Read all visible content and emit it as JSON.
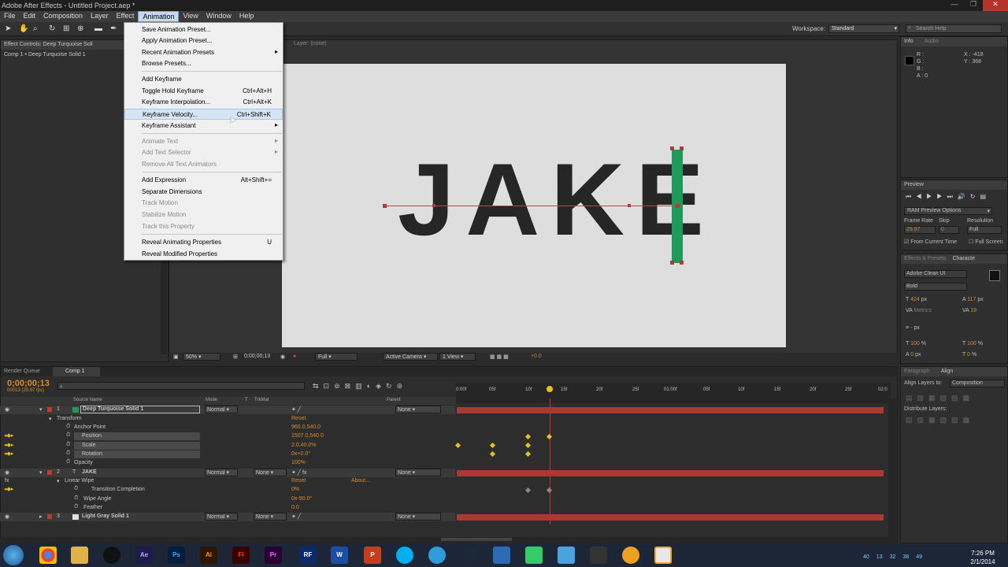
{
  "window": {
    "title": "Adobe After Effects - Untitled Project.aep *"
  },
  "menubar": {
    "items": [
      "File",
      "Edit",
      "Composition",
      "Layer",
      "Effect",
      "Animation",
      "View",
      "Window",
      "Help"
    ]
  },
  "animation_menu": {
    "save_preset": "Save Animation Preset...",
    "apply_preset": "Apply Animation Preset...",
    "recent_presets": "Recent Animation Presets",
    "browse_presets": "Browse Presets...",
    "add_keyframe": "Add Keyframe",
    "toggle_hold": "Toggle Hold Keyframe",
    "toggle_hold_sc": "Ctrl+Alt+H",
    "kf_interp": "Keyframe Interpolation...",
    "kf_interp_sc": "Ctrl+Alt+K",
    "kf_velocity": "Keyframe Velocity...",
    "kf_velocity_sc": "Ctrl+Shift+K",
    "kf_assistant": "Keyframe Assistant",
    "animate_text": "Animate Text",
    "add_text_selector": "Add Text Selector",
    "remove_text_animators": "Remove All Text Animators",
    "add_expression": "Add Expression",
    "add_expression_sc": "Alt+Shift+=",
    "separate_dims": "Separate Dimensions",
    "track_motion": "Track Motion",
    "stabilize_motion": "Stabilize Motion",
    "track_property": "Track this Property",
    "reveal_animating": "Reveal Animating Properties",
    "reveal_animating_sc": "U",
    "reveal_modified": "Reveal Modified Properties"
  },
  "toolbar": {
    "workspace_label": "Workspace:",
    "workspace_value": "Standard",
    "search_placeholder": "Search Help"
  },
  "effect_controls": {
    "tab": "Effect Controls: Deep Turquoise Soli",
    "breadcrumb": "Comp 1 • Deep Turquoise Solid 1"
  },
  "layer_panel": {
    "label": "Layer: (none)"
  },
  "viewer": {
    "text": "JAKE",
    "zoom": "50%",
    "timecode": "0;00;00;13",
    "resolution": "Full",
    "camera": "Active Camera",
    "views": "1 View",
    "exposure": "+0.0"
  },
  "info": {
    "tab": "Info",
    "tab2": "Audio",
    "r": "R :",
    "g": "G :",
    "b": "B :",
    "a": "A : 0",
    "x": "X : -418",
    "y": "Y : 368"
  },
  "preview": {
    "tab": "Preview",
    "ram_options": "RAM Preview Options",
    "frame_rate_label": "Frame Rate",
    "skip_label": "Skip",
    "resolution_label": "Resolution",
    "frame_rate": "29.97",
    "skip": "0",
    "resolution": "Full",
    "from_current": "From Current Time",
    "full_screen": "Full Screen"
  },
  "character": {
    "tab1": "Effects & Presets",
    "tab2": "Characte",
    "font": "Adobe Clean UI",
    "style": "Bold",
    "size": "424",
    "size_unit": "px",
    "leading": "117",
    "leading_unit": "px",
    "kerning": "Metrics",
    "tracking": "19",
    "stroke_unit": "px",
    "v_scale": "100",
    "h_scale": "100",
    "pct": "%",
    "baseline": "0",
    "baseline_unit": "px",
    "tsume": "0",
    "tsume_pct": "%"
  },
  "align": {
    "tab1": "Paragraph",
    "tab2": "Align",
    "align_to_label": "Align Layers to:",
    "align_to_value": "Composition",
    "distribute": "Distribute Layers:"
  },
  "timeline": {
    "tabs": [
      "Render Queue",
      "Comp 1"
    ],
    "timecode": "0;00;00;13",
    "fps": "00013 (29.97 fps)",
    "columns": {
      "source": "Source Name",
      "mode": "Mode",
      "t": "T",
      "trkmat": "TrkMat",
      "parent": "Parent"
    },
    "ruler": [
      "0:00f",
      "05f",
      "10f",
      "15f",
      "20f",
      "25f",
      "01:00f",
      "05f",
      "10f",
      "15f",
      "20f",
      "25f",
      "02:0"
    ],
    "layers": [
      {
        "num": "1",
        "name": "Deep Turquoise Solid 1",
        "mode": "Normal",
        "parent": "None",
        "color": "#1e9b58"
      },
      {
        "num": "2",
        "name": "JAKE",
        "mode": "Normal",
        "trkmat": "None",
        "parent": "None",
        "color": "#c0392b"
      },
      {
        "num": "3",
        "name": "Light Gray Solid 1",
        "mode": "Normal",
        "trkmat": "None",
        "parent": "None",
        "color": "#e0e0e0"
      }
    ],
    "props": {
      "transform": "Transform",
      "reset": "Reset",
      "anchor": "Anchor Point",
      "anchor_val": "960.0,540.0",
      "position": "Position",
      "position_val": "1507.0,540.0",
      "scale": "Scale",
      "scale_val": "2.0,40.0%",
      "rotation": "Rotation",
      "rotation_val": "0x+0.0°",
      "opacity": "Opacity",
      "opacity_val": "100%",
      "linear_wipe": "Linear Wipe",
      "reset2": "Reset",
      "about": "About...",
      "transition": "Transition Completion",
      "transition_val": "0%",
      "wipe_angle": "Wipe Angle",
      "wipe_angle_val": "0x-90.0°",
      "feather": "Feather",
      "feather_val": "0.0"
    }
  },
  "clock": {
    "time": "7:26 PM",
    "date": "2/1/2014"
  },
  "tray": [
    "40",
    "13",
    "32",
    "38",
    "49"
  ],
  "taskbar_labels": {
    "ae": "Ae",
    "ps": "Ps",
    "ai": "Ai",
    "fl": "Fl",
    "pr": "Pr",
    "rf": "RF",
    "wd": "W",
    "pp": "P"
  }
}
